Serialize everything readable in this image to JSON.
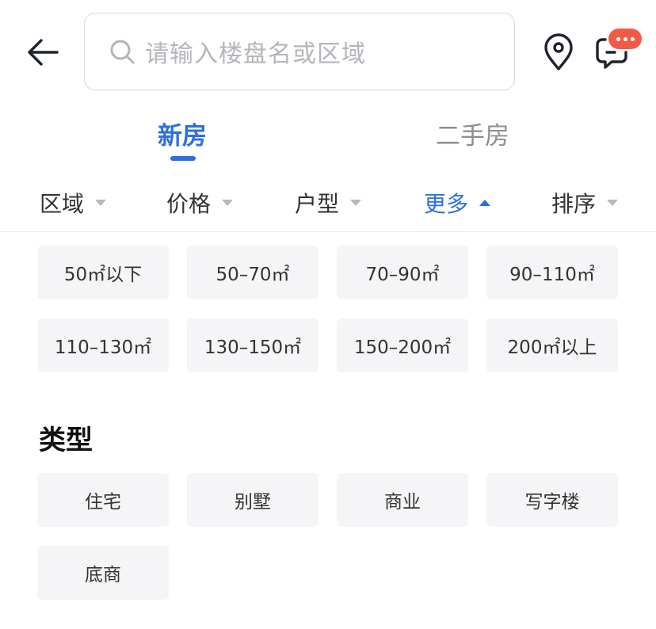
{
  "search": {
    "placeholder": "请输入楼盘名或区域"
  },
  "tabs": [
    {
      "label": "新房",
      "active": true
    },
    {
      "label": "二手房",
      "active": false
    }
  ],
  "filters": [
    {
      "label": "区域",
      "active": false
    },
    {
      "label": "价格",
      "active": false
    },
    {
      "label": "户型",
      "active": false
    },
    {
      "label": "更多",
      "active": true
    }
  ],
  "sort": {
    "label": "排序"
  },
  "area_options": [
    "50㎡以下",
    "50–70㎡",
    "70–90㎡",
    "90–110㎡",
    "110–130㎡",
    "130–150㎡",
    "150–200㎡",
    "200㎡以上"
  ],
  "type_section": {
    "title": "类型",
    "options": [
      "住宅",
      "别墅",
      "商业",
      "写字楼",
      "底商"
    ]
  },
  "colors": {
    "accent": "#2f6fde",
    "badge": "#f25a47",
    "chip_bg": "#f5f5f7"
  },
  "icons": [
    "back-arrow-icon",
    "search-icon",
    "location-pin-icon",
    "message-icon",
    "caret-down-icon",
    "caret-up-icon"
  ]
}
